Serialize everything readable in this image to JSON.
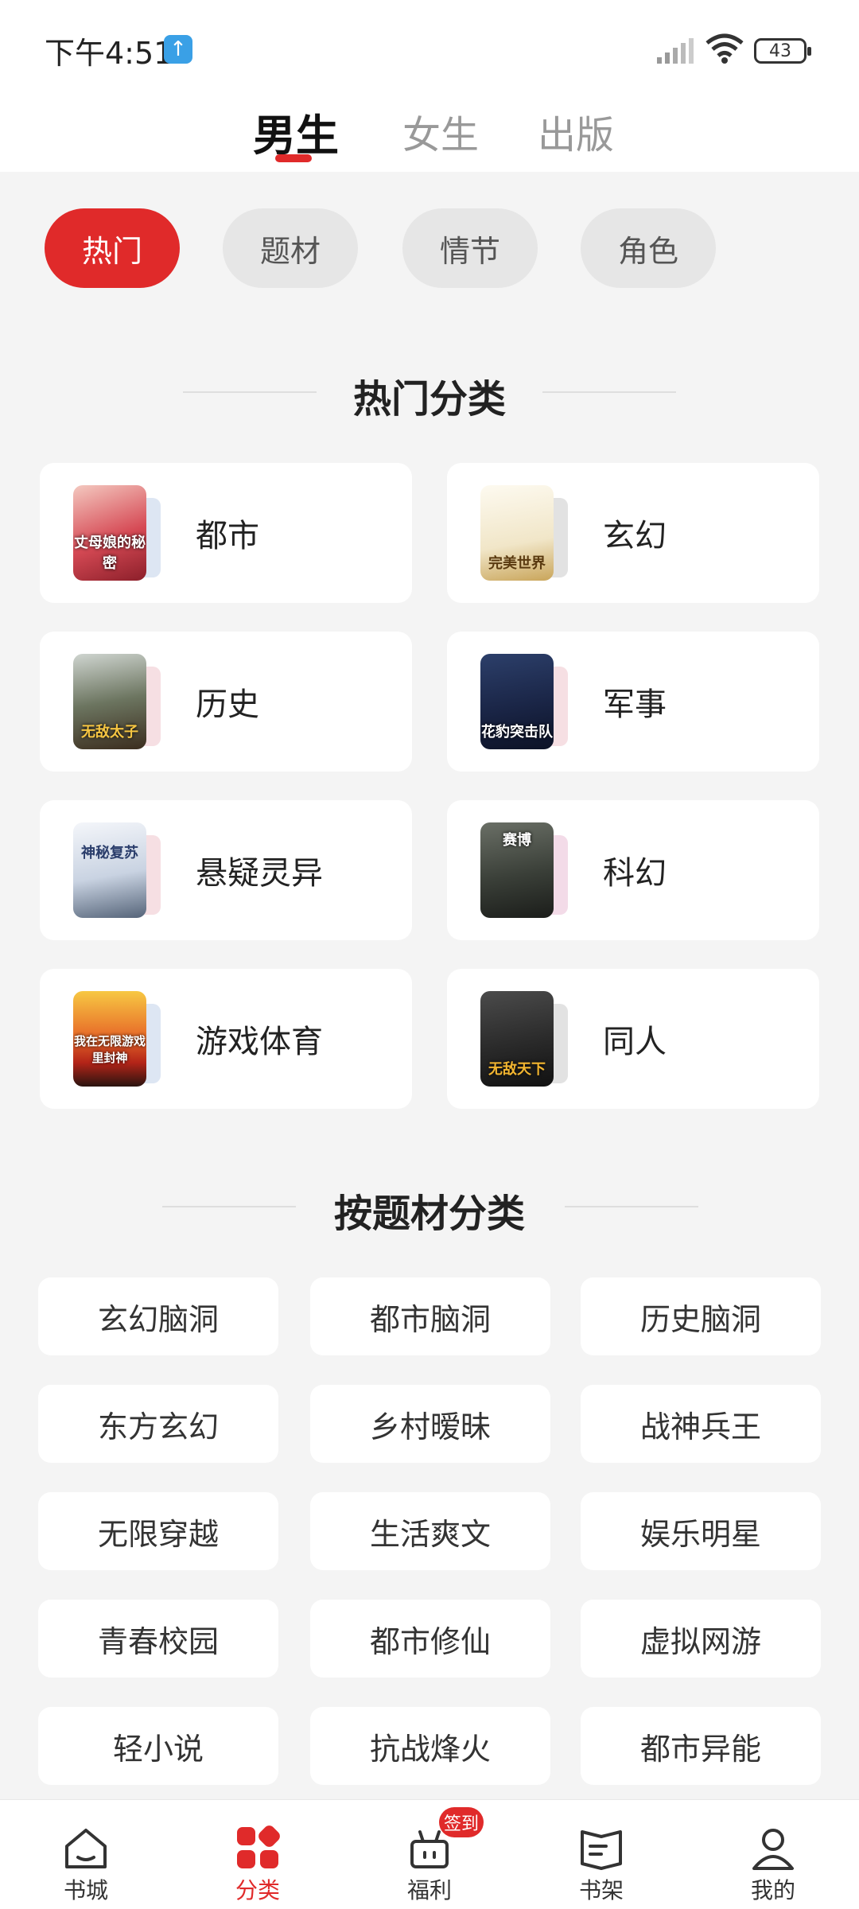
{
  "status_bar": {
    "time": "下午4:51",
    "battery": "43"
  },
  "top_tabs": [
    {
      "label": "男生",
      "active": true
    },
    {
      "label": "女生",
      "active": false
    },
    {
      "label": "出版",
      "active": false
    }
  ],
  "filters": [
    {
      "label": "热门",
      "active": true
    },
    {
      "label": "题材",
      "active": false
    },
    {
      "label": "情节",
      "active": false
    },
    {
      "label": "角色",
      "active": false
    }
  ],
  "hot_section": {
    "title": "热门分类",
    "items": [
      {
        "label": "都市",
        "cover_text": "丈母娘的秘密"
      },
      {
        "label": "玄幻",
        "cover_text": "完美世界"
      },
      {
        "label": "历史",
        "cover_text": "无敌太子"
      },
      {
        "label": "军事",
        "cover_text": "花豹突击队"
      },
      {
        "label": "悬疑灵异",
        "cover_text": "神秘复苏"
      },
      {
        "label": "科幻",
        "cover_text": "赛博"
      },
      {
        "label": "游戏体育",
        "cover_text": "我在无限游戏里封神"
      },
      {
        "label": "同人",
        "cover_text": "无敌天下"
      }
    ]
  },
  "topic_section": {
    "title": "按题材分类",
    "items": [
      "玄幻脑洞",
      "都市脑洞",
      "历史脑洞",
      "东方玄幻",
      "乡村暧昧",
      "战神兵王",
      "无限穿越",
      "生活爽文",
      "娱乐明星",
      "青春校园",
      "都市修仙",
      "虚拟网游",
      "轻小说",
      "抗战烽火",
      "都市异能"
    ]
  },
  "bottom_nav": {
    "items": [
      {
        "label": "书城",
        "icon": "home-icon",
        "active": false
      },
      {
        "label": "分类",
        "icon": "category-icon",
        "active": true
      },
      {
        "label": "福利",
        "icon": "gift-icon",
        "active": false
      },
      {
        "label": "书架",
        "icon": "bookshelf-icon",
        "active": false
      },
      {
        "label": "我的",
        "icon": "profile-icon",
        "active": false
      }
    ],
    "badge": "签到"
  },
  "colors": {
    "accent": "#e02a2a",
    "background": "#f4f4f4"
  }
}
